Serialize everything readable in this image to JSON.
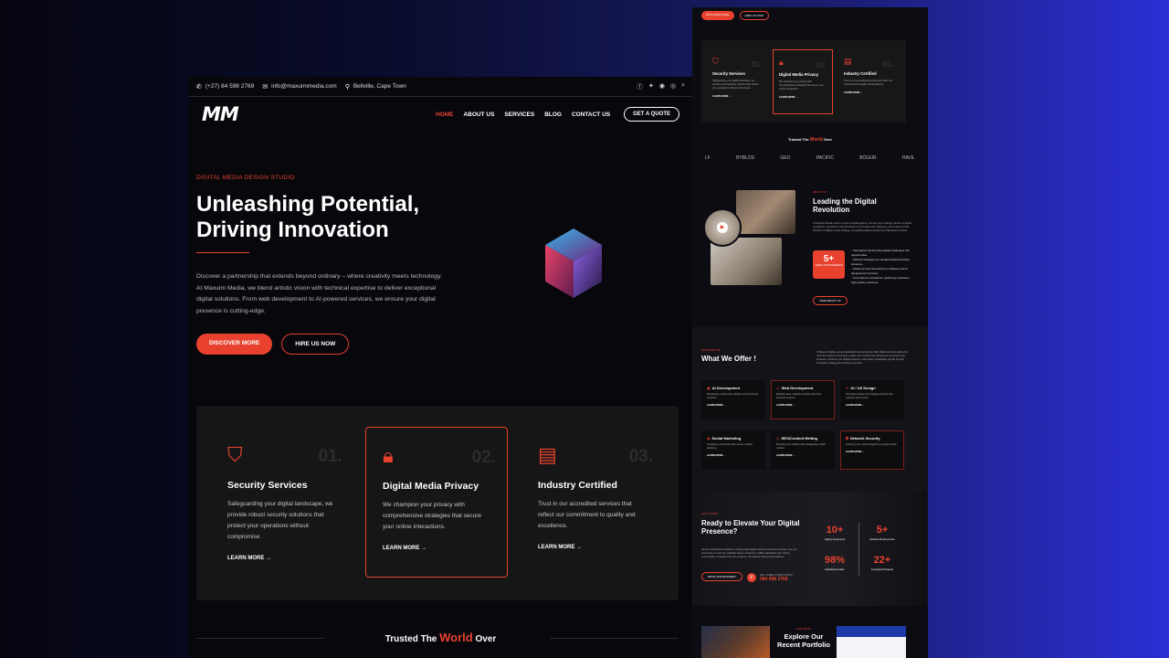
{
  "left": {
    "topbar": {
      "phone": "(+27) 84 598 2769",
      "email": "info@maxuimmedia.com",
      "location": "Bellville, Cape Town"
    },
    "nav": {
      "logo": "MM",
      "items": [
        "HOME",
        "ABOUT US",
        "SERVICES",
        "BLOG",
        "CONTACT US"
      ],
      "quote_button": "GET A QUOTE"
    },
    "hero": {
      "eyebrow": "DIGITAL MEDIA DESIGN STUDIO",
      "title_line1": "Unleashing Potential,",
      "title_line2": "Driving Innovation",
      "description": "Discover a partnership that extends beyond ordinary – where creativity meets technology. At Maxuim Media, we blend artistic vision with technical expertise to deliver exceptional digital solutions. From web development to AI-powered services, we ensure your digital presence is cutting-edge.",
      "primary_button": "DISCOVER MORE",
      "secondary_button": "HIRE US NOW"
    },
    "features": [
      {
        "num": "01.",
        "title": "Security Services",
        "desc": "Safeguarding your digital landscape, we provide robust security solutions that protect your operations without compromise.",
        "link": "LEARN MORE →"
      },
      {
        "num": "02.",
        "title": "Digital Media Privacy",
        "desc": "We champion your privacy with comprehensive strategies that secure your online interactions.",
        "link": "LEARN MORE →"
      },
      {
        "num": "03.",
        "title": "Industry Certified",
        "desc": "Trust in our accredited services that reflect our commitment to quality and excellence.",
        "link": "LEARN MORE →"
      }
    ],
    "trusted": {
      "pre": "Trusted The ",
      "word": "World",
      "post": " Over"
    }
  },
  "right": {
    "top_buttons": [
      "DISCOVER MORE",
      "HIRE US NOW"
    ],
    "features": [
      {
        "num": "01.",
        "title": "Security Services",
        "desc": "Safeguarding your digital landscape, we provide robust security solutions that protect your operations without compromise.",
        "link": "LEARN MORE →"
      },
      {
        "num": "02.",
        "title": "Digital Media Privacy",
        "desc": "We champion your privacy with comprehensive strategies that secure your online interactions.",
        "link": "LEARN MORE →"
      },
      {
        "num": "03.",
        "title": "Industry Certified",
        "desc": "Trust in our accredited services that reflect our commitment to quality and excellence.",
        "link": "LEARN MORE →"
      }
    ],
    "trusted": {
      "pre": "Trusted The ",
      "word": "World",
      "post": " Over"
    },
    "logos": [
      "LF",
      "BYBLOS",
      "GEO",
      "PACIFIC",
      "BÖLEIR",
      "HAVIL"
    ],
    "about": {
      "eyebrow": "ABOUT US",
      "title": "Leading the Digital Revolution",
      "desc": "At Maxuim Media, we're not just a digital agency; we are your strategic partner in digital excellence. Founded on the principles of innovation and efficiency, we're driven at the forefront of digital media strategy, compelling digital experiences that deliver results.",
      "badge_value": "5+",
      "badge_label": "YEARS OF EXPERIENCE",
      "bullets": [
        "Fast-paced transforming digital challenges into opportunities.",
        "Tailored strategies for elevated digital business presence.",
        "Advanced web development, software and AI development services.",
        "Committed to excellence, delivering consistent high-quality outcomes."
      ],
      "button": "VIEW ABOUT US"
    },
    "offer": {
      "eyebrow": "SERVICES WE",
      "title": "What We Offer !",
      "desc": "At Maxuim Media, we are dedicated to providing top-flight digital solutions tailored to meet the needs of a dynamic market. Our services are designed to empower your business, enhance your digital presence, and ensure sustainable growth through innovative strategy and creative execution.",
      "services": [
        {
          "title": "AI Development",
          "desc": "Developing cutting-edge software and AI-infused solutions.",
          "link": "LEARN MORE →"
        },
        {
          "title": "Web Development",
          "desc": "Building sleek, scalable websites that drive business success.",
          "link": "LEARN MORE →"
        },
        {
          "title": "UI / UX Design",
          "desc": "Providing intuitive and engaging designs that captivate and convert.",
          "link": "LEARN MORE →"
        },
        {
          "title": "Social Marketing",
          "desc": "Amplifying your brand voice across multiple platforms.",
          "link": "LEARN MORE →"
        },
        {
          "title": "SEO/Content Writing",
          "desc": "Boosting your visibility with strategically crafted content.",
          "link": "LEARN MORE →"
        },
        {
          "title": "Network Security",
          "desc": "Fortifying your network against emerging threats.",
          "link": "LEARN MORE →"
        }
      ]
    },
    "cta": {
      "eyebrow": "LET'S WORK",
      "title": "Ready to Elevate Your Digital Presence?",
      "desc": "Partner with Maxuim Media for cutting-edge digital solutions that drive success. Join our community of over 10+ satisfied clients, backed by a 98% satisfaction rate. We've successfully completed over 22+ projects, consistently delivering excellence.",
      "button": "BOOK APPOINTMENT",
      "phone_label": "GET A FREE CONSULTATION",
      "phone": "084 598 2769",
      "stats": [
        {
          "value": "10+",
          "label": "Happy Customers"
        },
        {
          "value": "5+",
          "label": "Solution Deployments"
        },
        {
          "value": "98%",
          "label": "Satisfaction Rate"
        },
        {
          "value": "22+",
          "label": "Completed Projects"
        }
      ]
    },
    "portfolio": {
      "eyebrow": "OUR WORK",
      "title": "Explore Our Recent Portfolio"
    }
  }
}
